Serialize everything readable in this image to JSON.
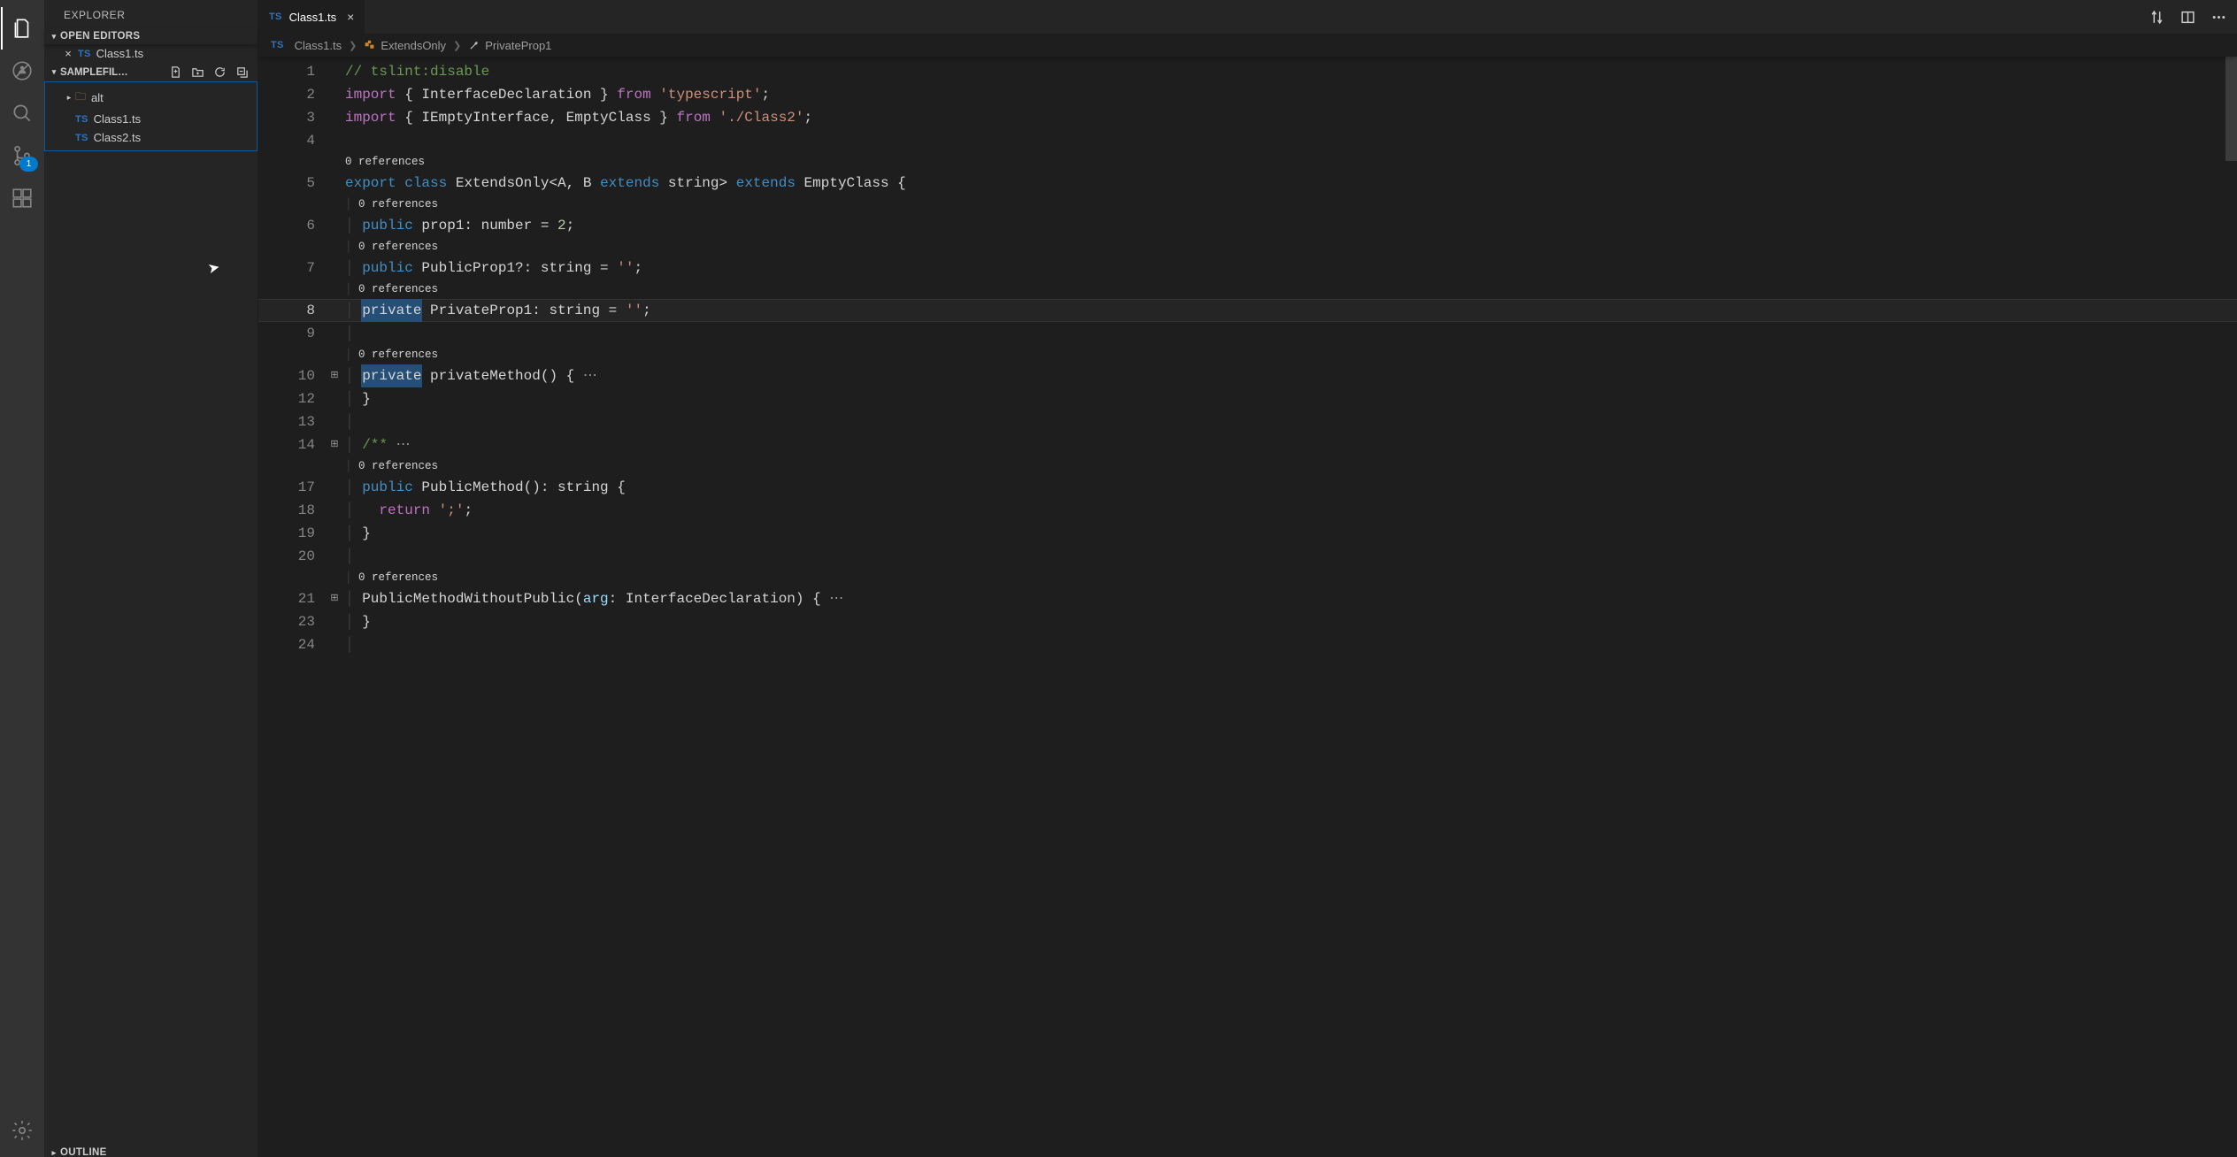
{
  "sidebar": {
    "title": "EXPLORER",
    "openEditorsLabel": "OPEN EDITORS",
    "openEditors": [
      {
        "name": "Class1.ts"
      }
    ],
    "folderLabel": "SAMPLEFIL…",
    "tree": {
      "folder": {
        "name": "alt",
        "expanded": false
      },
      "files": [
        {
          "name": "Class1.ts"
        },
        {
          "name": "Class2.ts"
        }
      ]
    },
    "outlineLabel": "OUTLINE"
  },
  "activityBadge": "1",
  "tabs": [
    {
      "name": "Class1.ts",
      "lang": "TS"
    }
  ],
  "breadcrumb": {
    "file": "Class1.ts",
    "class": "ExtendsOnly",
    "member": "PrivateProp1"
  },
  "codelens": "0 references",
  "lines": {
    "l1": {
      "n": "1"
    },
    "l2": {
      "n": "2"
    },
    "l3": {
      "n": "3"
    },
    "l4": {
      "n": "4"
    },
    "l5": {
      "n": "5"
    },
    "l6": {
      "n": "6"
    },
    "l7": {
      "n": "7"
    },
    "l8": {
      "n": "8"
    },
    "l9": {
      "n": "9"
    },
    "l10": {
      "n": "10"
    },
    "l12": {
      "n": "12"
    },
    "l13": {
      "n": "13"
    },
    "l14": {
      "n": "14"
    },
    "l17": {
      "n": "17"
    },
    "l18": {
      "n": "18"
    },
    "l19": {
      "n": "19"
    },
    "l20": {
      "n": "20"
    },
    "l21": {
      "n": "21"
    },
    "l23": {
      "n": "23"
    },
    "l24": {
      "n": "24"
    }
  },
  "code": {
    "c1_cmt": "// tslint:disable",
    "c2_import": "import",
    "c2_br1": " { ",
    "c2_t": "InterfaceDeclaration",
    "c2_br2": " } ",
    "c2_from": "from",
    "c2_s": " 'typescript'",
    "c2_semi": ";",
    "c3_import": "import",
    "c3_br1": " { ",
    "c3_t": "IEmptyInterface, EmptyClass",
    "c3_br2": " } ",
    "c3_from": "from",
    "c3_s": " './Class2'",
    "c3_semi": ";",
    "c5_export": "export",
    "c5_sp1": " ",
    "c5_class": "class",
    "c5_sp2": " ",
    "c5_name": "ExtendsOnly<A, B ",
    "c5_extends1": "extends",
    "c5_type": " string> ",
    "c5_extends2": "extends",
    "c5_base": " EmptyClass {",
    "c6_indent": "  ",
    "c6_pub": "public",
    "c6_rest": " prop1: number = ",
    "c6_num": "2",
    "c6_semi": ";",
    "c7_indent": "  ",
    "c7_pub": "public",
    "c7_rest": " PublicProp1?: string = ",
    "c7_str": "''",
    "c7_semi": ";",
    "c8_indent": "  ",
    "c8_priv": "private",
    "c8_rest": " PrivateProp1: string = ",
    "c8_str": "''",
    "c8_semi": ";",
    "c10_indent": "  ",
    "c10_priv": "private",
    "c10_rest": " privateMethod() { ",
    "c10_dots": "⋯",
    "c12_indent": "  ",
    "c12_txt": "}",
    "c14_indent": "  ",
    "c14_cmt": "/** ",
    "c14_dots": "⋯",
    "c17_indent": "  ",
    "c17_pub": "public",
    "c17_rest": " PublicMethod(): string {",
    "c18_indent": "    ",
    "c18_ret": "return",
    "c18_sp": " ",
    "c18_str": "';'",
    "c18_semi": ";",
    "c19_indent": "  ",
    "c19_txt": "}",
    "c21_indent": "  ",
    "c21_name": "PublicMethodWithoutPublic(",
    "c21_arg": "arg",
    "c21_rest": ": InterfaceDeclaration) { ",
    "c21_dots": "⋯",
    "c23_indent": "  ",
    "c23_txt": "}"
  }
}
